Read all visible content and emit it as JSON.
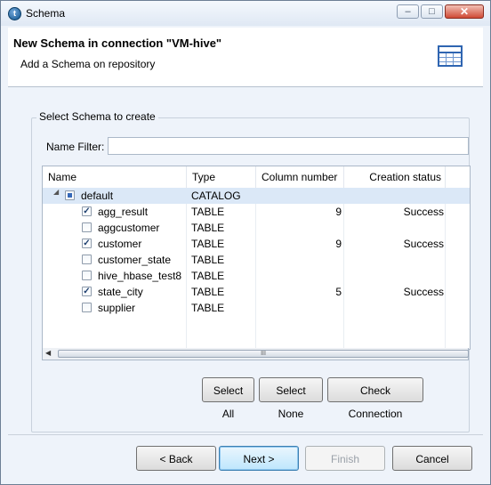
{
  "window": {
    "title": "Schema"
  },
  "titlebar": {
    "minimize": "–",
    "maximize": "□",
    "close": "✕"
  },
  "header": {
    "title": "New Schema in connection \"VM-hive\"",
    "subtitle": "Add a Schema on repository",
    "icon": "table-icon"
  },
  "group": {
    "label": "Select Schema to create"
  },
  "filter": {
    "label": "Name Filter:",
    "value": "",
    "placeholder": ""
  },
  "table": {
    "columns": [
      "Name",
      "Type",
      "Column number",
      "Creation status"
    ],
    "catalog": {
      "name": "default",
      "type": "CATALOG",
      "check_state": "partial",
      "expanded": true
    },
    "rows": [
      {
        "name": "agg_result",
        "type": "TABLE",
        "column_number": "9",
        "status": "Success",
        "checked": true
      },
      {
        "name": "aggcustomer",
        "type": "TABLE",
        "column_number": "",
        "status": "",
        "checked": false
      },
      {
        "name": "customer",
        "type": "TABLE",
        "column_number": "9",
        "status": "Success",
        "checked": true
      },
      {
        "name": "customer_state",
        "type": "TABLE",
        "column_number": "",
        "status": "",
        "checked": false
      },
      {
        "name": "hive_hbase_test8",
        "type": "TABLE",
        "column_number": "",
        "status": "",
        "checked": false
      },
      {
        "name": "state_city",
        "type": "TABLE",
        "column_number": "5",
        "status": "Success",
        "checked": true
      },
      {
        "name": "supplier",
        "type": "TABLE",
        "column_number": "",
        "status": "",
        "checked": false
      }
    ]
  },
  "scrollbar": {
    "grip": "III"
  },
  "actions": {
    "select_all": "Select All",
    "select_none": "Select None",
    "check_connection": "Check Connection"
  },
  "footer": {
    "back": "< Back",
    "next": "Next >",
    "finish": "Finish",
    "cancel": "Cancel"
  },
  "colors": {
    "selection": "#dbe8f7",
    "accent": "#3c7fb1"
  }
}
